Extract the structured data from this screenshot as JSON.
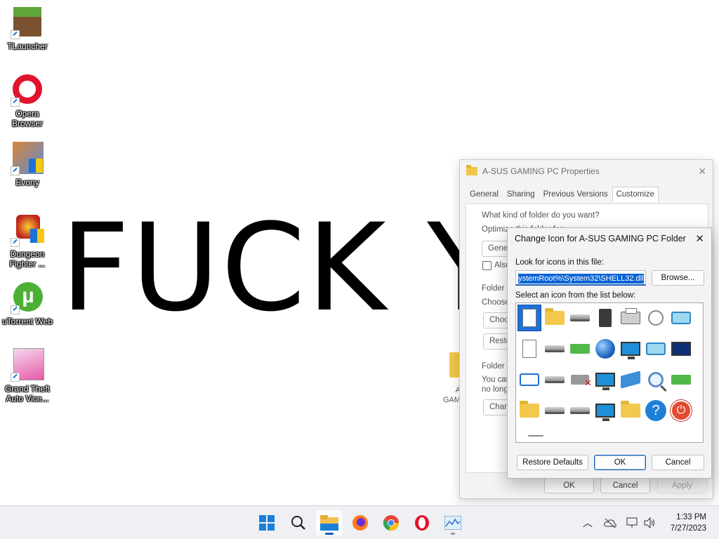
{
  "desktop": {
    "icons": [
      {
        "label": "TLauncher"
      },
      {
        "label": "Opera Browser"
      },
      {
        "label": "Evony"
      },
      {
        "label": "Dungeon Fighter ..."
      },
      {
        "label": "uTorrent Web"
      },
      {
        "label": "Grand Theft Auto Vice..."
      }
    ],
    "wallpaper_text": "FUCK Y"
  },
  "properties_window": {
    "title": "A-SUS GAMING PC Properties",
    "tabs": [
      "General",
      "Sharing",
      "Previous Versions",
      "Customize"
    ],
    "active_tab": "Customize",
    "folder_type_group": "What kind of folder do you want?",
    "optimize_label": "Optimize this folder for:",
    "optimize_value": "Genera",
    "also_apply": "Also",
    "folder_pictures_group": "Folder p",
    "choose_label": "Choose",
    "choose_button": "Choo",
    "restore_button": "Resto",
    "folder_icons_group": "Folder ic",
    "you_can_text": "You can",
    "no_longer_text": "no longe",
    "change_button": "Chan",
    "ok": "OK",
    "cancel": "Cancel",
    "apply": "Apply"
  },
  "background_folder": {
    "label_line1": "A",
    "label_line2": "GAM"
  },
  "change_icon_dialog": {
    "title": "Change Icon for A-SUS GAMING PC Folder",
    "look_for_label": "Look for icons in this file:",
    "file_path": "ystemRoot%\\System32\\SHELL32.dll",
    "browse": "Browse...",
    "select_label": "Select an icon from the list below:",
    "restore_defaults": "Restore Defaults",
    "ok": "OK",
    "cancel": "Cancel",
    "icons_row1": [
      "blank-document-icon",
      "folder-icon",
      "drive-icon",
      "chip-icon",
      "printer-icon",
      "clock-document-icon",
      "network-card-icon"
    ],
    "icons_row2": [
      "text-document-icon",
      "drive-floppy-icon",
      "drive-green-icon",
      "globe-icon",
      "network-globe-icon",
      "control-panel-icon",
      "sleep-monitor-icon"
    ],
    "icons_row3": [
      "app-window-icon",
      "floppy-drive-icon",
      "drive-error-icon",
      "network-globe-icon",
      "network-connection-icon",
      "search-icon",
      "usb-drive-icon"
    ],
    "icons_row4": [
      "folder-icon",
      "drive-icon",
      "cd-drive-icon",
      "monitor-icon",
      "apps-folder-icon",
      "help-icon",
      "power-icon"
    ]
  },
  "taskbar": {
    "apps": [
      "start",
      "search",
      "file-explorer",
      "firefox",
      "chrome",
      "opera",
      "task-manager"
    ],
    "time": "1:33 PM",
    "date": "7/27/2023"
  }
}
